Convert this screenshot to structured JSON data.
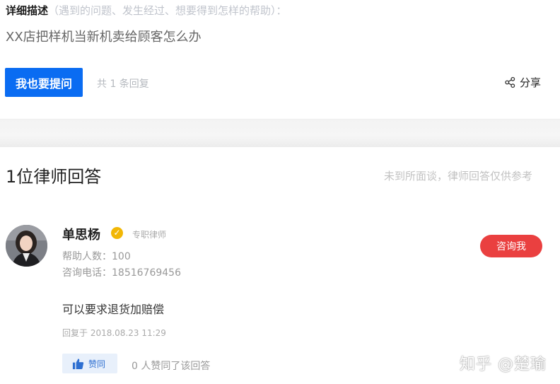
{
  "question": {
    "detail_label": "详细描述",
    "detail_hint": "（遇到的问题、发生经过、想要得到怎样的帮助）：",
    "text": "XX店把样机当新机卖给顾客怎么办",
    "ask_button": "我也要提问",
    "reply_count": "共 1 条回复",
    "share_label": "分享"
  },
  "answers": {
    "title": "1位律师回答",
    "disclaimer": "未到所面谈，律师回答仅供参考",
    "items": [
      {
        "name": "单思杨",
        "verified_badge": "✓",
        "tag": "专职律师",
        "help_count": "帮助人数：100",
        "phone": "咨询电话：18516769456",
        "consult_button": "咨询我",
        "answer": "可以要求退货加赔偿",
        "reply_time": "回复于 2018.08.23 11:29",
        "like_button": "赞同",
        "like_info": "0 人赞同了该回答"
      }
    ]
  },
  "watermark": "知乎 @楚瑜",
  "colors": {
    "primary_blue": "#0a6cf2",
    "consult_red": "#ea4040",
    "verified_gold": "#f2b705"
  },
  "icons": [
    "share-icon",
    "verified-icon",
    "thumbs-up-icon"
  ]
}
